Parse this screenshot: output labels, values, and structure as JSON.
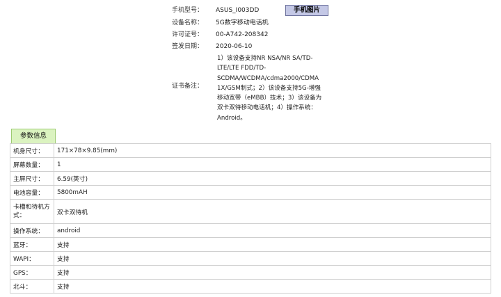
{
  "info": {
    "model_label": "手机型号：",
    "model_value": "ASUS_I003DD",
    "photo_button": "手机图片",
    "device_name_label": "设备名称：",
    "device_name_value": "5G数字移动电话机",
    "license_label": "许可证号：",
    "license_value": "00-A742-208342",
    "issue_date_label": "签发日期：",
    "issue_date_value": "2020-06-10",
    "remark_label": "证书备注：",
    "remark_lines": [
      "1）该设备支持NR NSA/NR SA/TD-",
      "LTE/LTE FDD/TD-",
      "SCDMA/WCDMA/cdma2000/CDMA",
      "1X/GSM制式；2）该设备支持5G-增强",
      "移动宽带（eMBB）技术；3）该设备为",
      "双卡双待移动电话机；4）操作系统：",
      "Android。"
    ]
  },
  "params": {
    "tab_label": "参数信息",
    "rows": [
      {
        "key": "机身尺寸：",
        "value": "171×78×9.85(mm)"
      },
      {
        "key": "屏幕数量：",
        "value": "1"
      },
      {
        "key": "主屏尺寸：",
        "value": "6.59(英寸)"
      },
      {
        "key": "电池容量：",
        "value": "5800mAH"
      },
      {
        "key": "卡槽和待机方式：",
        "key_lines": [
          "卡槽和待机方",
          "式："
        ],
        "value": "双卡双待机"
      },
      {
        "key": "操作系统：",
        "value": "android"
      },
      {
        "key": "蓝牙：",
        "value": "支持"
      },
      {
        "key": "WAPI：",
        "value": "支持"
      },
      {
        "key": "GPS：",
        "value": "支持"
      },
      {
        "key": "北斗：",
        "value": "支持"
      }
    ]
  }
}
